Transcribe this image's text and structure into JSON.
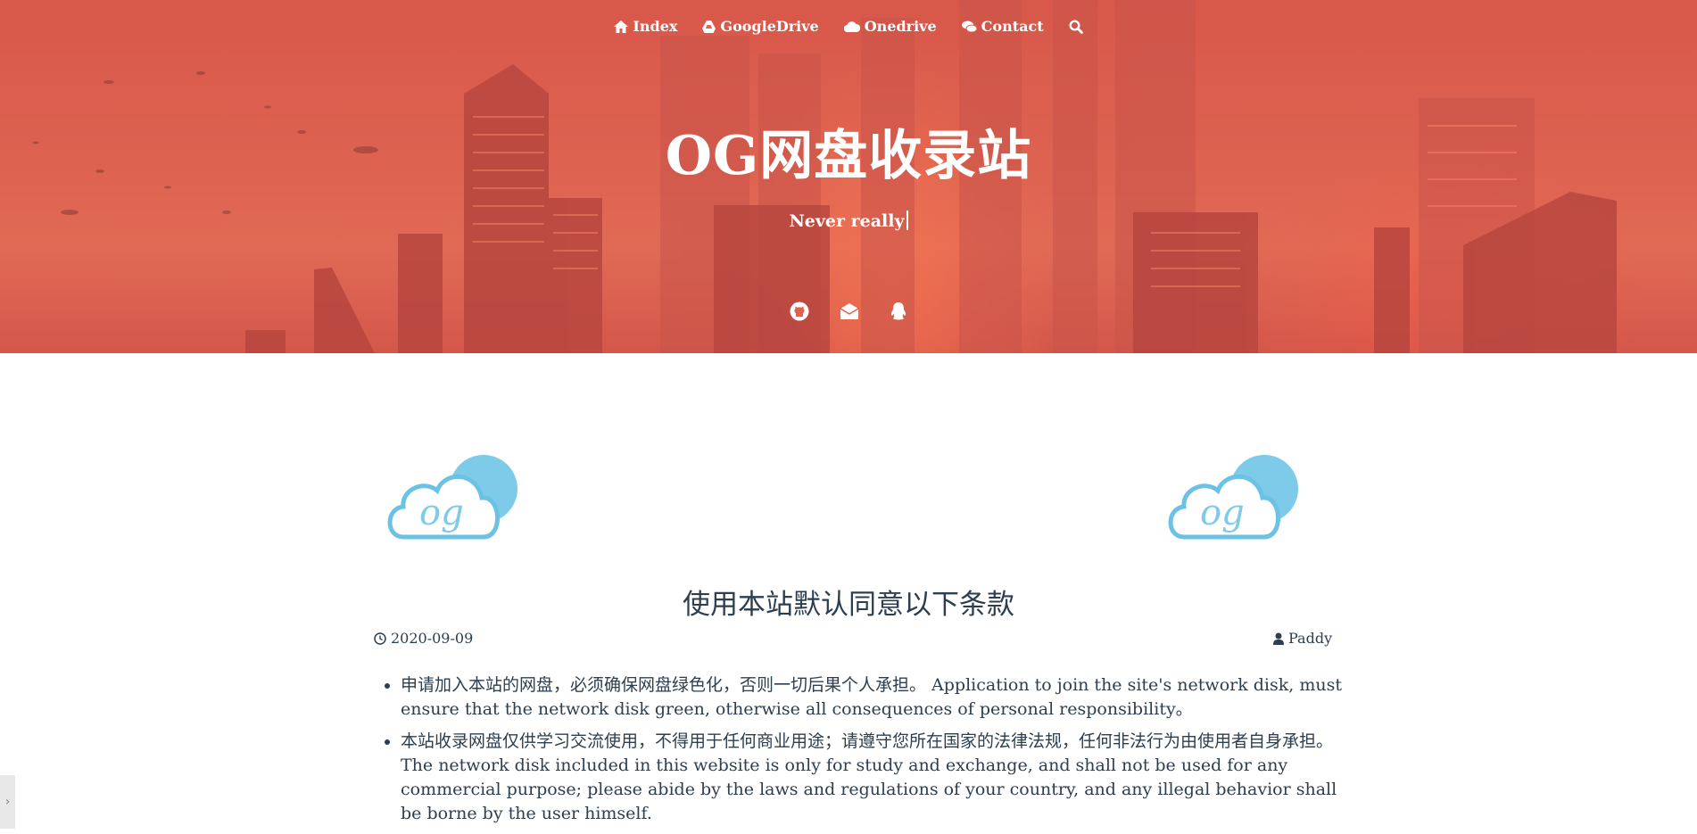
{
  "nav": {
    "items": [
      {
        "label": "Index",
        "icon": "home-icon"
      },
      {
        "label": "GoogleDrive",
        "icon": "google-drive-icon"
      },
      {
        "label": "Onedrive",
        "icon": "cloud-icon"
      },
      {
        "label": "Contact",
        "icon": "chat-icon"
      }
    ],
    "search_icon": "search-icon"
  },
  "hero": {
    "title": "OG网盘收录站",
    "subtitle": "Never really",
    "social": [
      "github-icon",
      "email-icon",
      "qq-icon"
    ]
  },
  "logo": {
    "text": "og",
    "colors": {
      "cloud_outline": "#6cc2e4",
      "cloud_fill": "#7ecbe9"
    }
  },
  "post": {
    "title": "使用本站默认同意以下条款",
    "date": "2020-09-09",
    "author": "Paddy",
    "terms": [
      "申请加入本站的网盘，必须确保网盘绿色化，否则一切后果个人承担。 Application to join the site's network disk, must ensure that the network disk green, otherwise all consequences of personal responsibility。",
      "本站收录网盘仅供学习交流使用，不得用于任何商业用途；请遵守您所在国家的法律法规，任何非法行为由使用者自身承担。The network disk included in this website is only for study and exchange, and shall not be used for any commercial purpose; please abide by the laws and regulations of your country, and any illegal behavior shall be borne by the user himself."
    ]
  },
  "colors": {
    "hero": "#dd6250",
    "text": "#2c3e50"
  }
}
